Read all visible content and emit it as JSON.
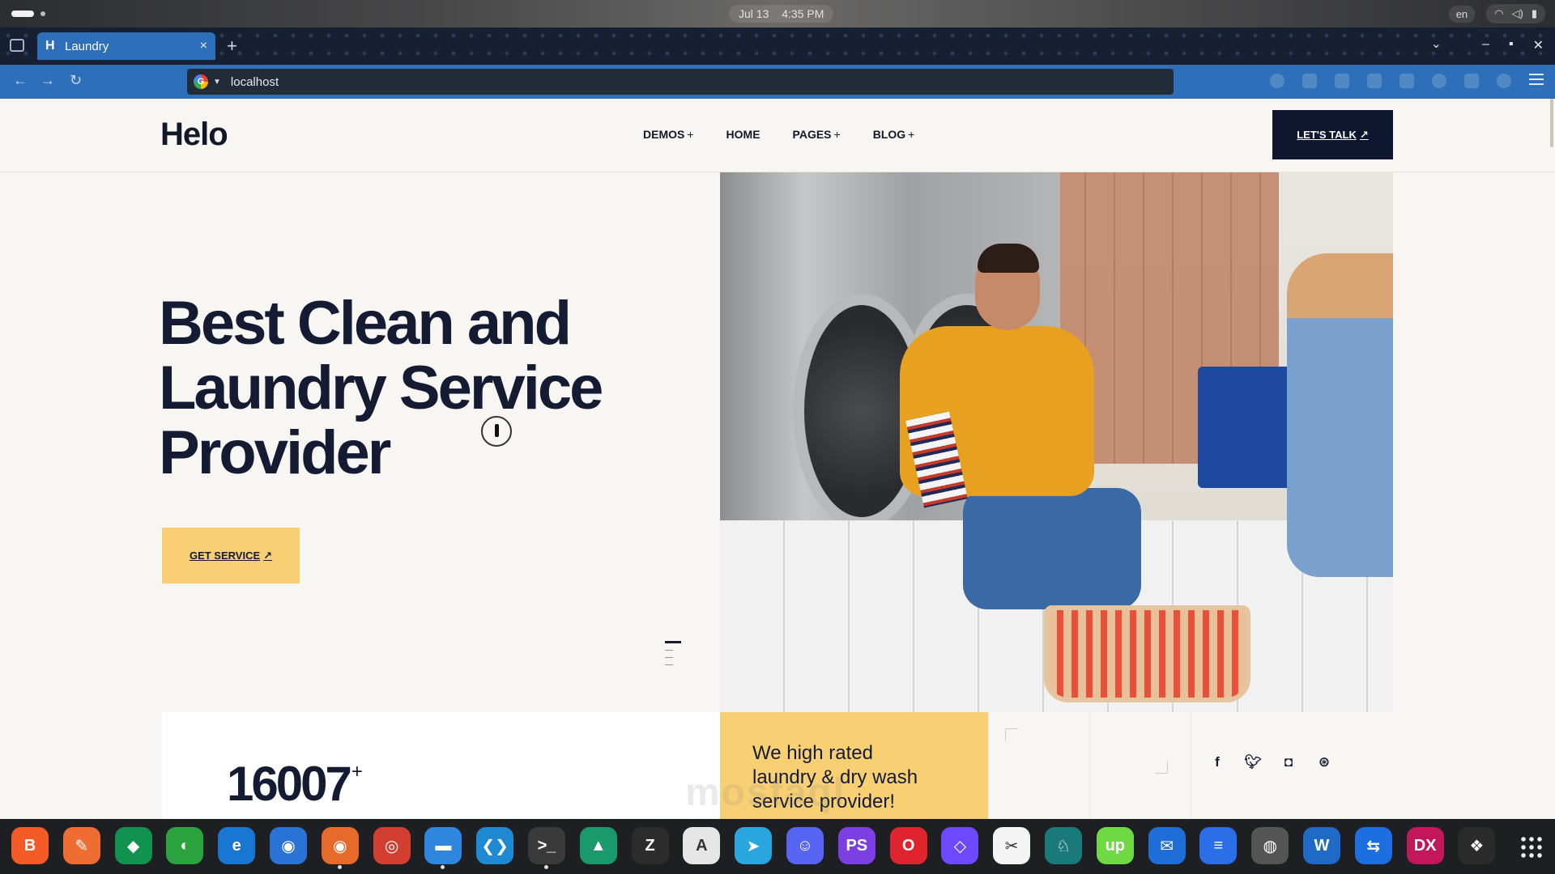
{
  "system": {
    "date": "Jul 13",
    "time": "4:35 PM",
    "lang": "en"
  },
  "browser": {
    "tab_title": "Laundry",
    "tab_favicon": "H",
    "url": "localhost"
  },
  "site": {
    "logo": "Helo",
    "nav": [
      {
        "label": "DEMOS",
        "has_submenu": true
      },
      {
        "label": "HOME",
        "has_submenu": false
      },
      {
        "label": "PAGES",
        "has_submenu": true
      },
      {
        "label": "BLOG",
        "has_submenu": true
      }
    ],
    "cta": "LET'S TALK",
    "hero": {
      "line1": "Best Clean and",
      "line2": "Laundry Service",
      "line3": "Provider",
      "button": "GET SERVICE"
    },
    "stats": {
      "number": "16007",
      "suffix": "+"
    },
    "rated": {
      "line1": "We high rated",
      "line2": "laundry & dry wash",
      "line3": "service provider!"
    },
    "social_icons": [
      "facebook-icon",
      "twitter-icon",
      "instagram-icon",
      "dribbble-icon"
    ]
  },
  "dock": {
    "apps": [
      {
        "name": "brave",
        "color": "#f25b26",
        "glyph": "B"
      },
      {
        "name": "postman",
        "color": "#ef6c33",
        "glyph": "✎"
      },
      {
        "name": "mongodb-compass",
        "color": "#12924f",
        "glyph": "◆"
      },
      {
        "name": "evolution",
        "color": "#2aa33f",
        "glyph": "◐"
      },
      {
        "name": "edge",
        "color": "#1777d2",
        "glyph": "e"
      },
      {
        "name": "firefox-dev",
        "color": "#2a73d6",
        "glyph": "◉"
      },
      {
        "name": "firefox",
        "color": "#e66a2a",
        "glyph": "◉"
      },
      {
        "name": "chrome",
        "color": "#d23f31",
        "glyph": "◎"
      },
      {
        "name": "files",
        "color": "#2e86de",
        "glyph": "▬"
      },
      {
        "name": "vscode",
        "color": "#1f8ad2",
        "glyph": "❮❯"
      },
      {
        "name": "terminal",
        "color": "#3a3a3a",
        "glyph": ">_"
      },
      {
        "name": "system-monitor",
        "color": "#1a9a6c",
        "glyph": "▲"
      },
      {
        "name": "text-editor",
        "color": "#2c2c2c",
        "glyph": "Z"
      },
      {
        "name": "app-center",
        "color": "#e6e6e6",
        "glyph": "A"
      },
      {
        "name": "telegram",
        "color": "#2aa6df",
        "glyph": "➤"
      },
      {
        "name": "discord",
        "color": "#5865f2",
        "glyph": "☺"
      },
      {
        "name": "phpstorm",
        "color": "#7b3fe4",
        "glyph": "PS"
      },
      {
        "name": "opera",
        "color": "#e0242d",
        "glyph": "O"
      },
      {
        "name": "protonvpn",
        "color": "#6d4aff",
        "glyph": "◇"
      },
      {
        "name": "obsidian",
        "color": "#f4f4f4",
        "glyph": "✂"
      },
      {
        "name": "gitkraken",
        "color": "#1a7a7a",
        "glyph": "♘"
      },
      {
        "name": "upwork",
        "color": "#6fda44",
        "glyph": "up"
      },
      {
        "name": "thunderbird",
        "color": "#1f6dd6",
        "glyph": "✉"
      },
      {
        "name": "slack-alt",
        "color": "#2b6fe8",
        "glyph": "≡"
      },
      {
        "name": "obs-studio",
        "color": "#555",
        "glyph": "◍"
      },
      {
        "name": "libreoffice-writer",
        "color": "#1e6ac6",
        "glyph": "W"
      },
      {
        "name": "teamviewer",
        "color": "#1d6ee0",
        "glyph": "⇆"
      },
      {
        "name": "jetbrains-dx",
        "color": "#c2185b",
        "glyph": "DX"
      },
      {
        "name": "figma",
        "color": "#2b2b2b",
        "glyph": "❖"
      }
    ]
  },
  "watermark": "mostaql"
}
